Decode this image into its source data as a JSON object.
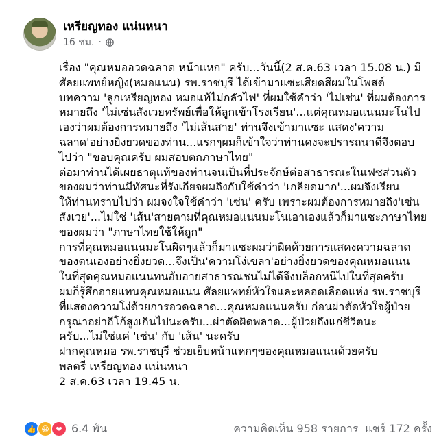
{
  "post": {
    "author": "เหรียญทอง แน่นหนา",
    "time": "16 ชม.",
    "lines": [
      "เรื่อง \"คุณหมออวดฉลาด หน้าแหก\" ครับ...วันนี้(2 ส.ค.63 เวลา 15.08 น.) มี",
      "ศัลยแพทย์หญิง(หมอแนน) รพ.ราชบุรี ได้เข้ามาแซะเสียดสีผมในโพสต์",
      "บทความ 'ลูกเหรียญทอง หมอแท้ไม่กลัวไฟ' ที่ผมใช้คำว่า 'ไม่เซ่น' ที่ผมต้องการ",
      "หมายถึง 'ไม่เซ่นสังเวยทรัพย์เพื่อให้ลูกเข้าโรงเรียน'...แต่คุณหมอแนนมะโนไป",
      "เองว่าผมต้องการหมายถึง 'ไม่เส้นสาย' ท่านจึงเข้ามาแซะ แสดง'ความ",
      "ฉลาด'อย่างยิ่งยวดของท่าน...แรกๆผมก็เข้าใจว่าท่านคงจะปรารถนาดีจึงตอบ",
      "ไปว่า \"ขอบคุณครับ ผมสอบตกภาษาไทย\"",
      "ต่อมาท่านได้เผยธาตุแท้ของท่านจนเป็นที่ประจักษ์ต่อสาธารณะในเฟซส่วนตัว",
      "ของผมว่าท่านมีทัศนะที่รังเกียจผมถึงกับใช้คำว่า 'เกลียดมาก'...ผมจึงเรียน",
      "ให้ท่านทราบไปว่า ผมจงใจใช้คำว่า 'เซ่น' ครับ เพราะผมต้องการหมายถึง'เซ่น",
      "สังเวย'...ไม่ใช่ 'เส้น'สายตามที่คุณหมอแนนมะโนเอาเองแล้วก็มาแซะภาษาไทย",
      "ของผมว่า \"ภาษาไทยใช้ให้ถูก\"",
      "การที่คุณหมอแนนมะโนผิดๆแล้วก็มาแซะผมว่าผิดด้วยการแสดงความฉลาด",
      "ของตนเองอย่างยิ่งยวด...จึงเป็น'ความโง่เขลา'อย่างยิ่งยวดของคุณหมอแนน",
      "ในที่สุดคุณหมอแนนทนอับอายสาธารณชนไม่ได้จึงบล็อกหนีไปในที่สุดครับ",
      "ผมก็รู้สึกอายแทนคุณหมอแนน ศัลยแพทย์หัวใจและหลอดเลือดแห่ง รพ.ราชบุรี",
      "ที่แสดงความโง่ด้วยการอวดฉลาด...คุณหมอแนนครับ ก่อนผ่าตัดหัวใจผู้ป่วย",
      "กรุณาอย่าอีโก้สูงเกินไปนะครับ...ผ่าตัดผิดพลาด...ผู้ป่วยถึงแก่ชีวิตนะ",
      "ครับ...ไม่ใช่แค่ 'เซ่น' กับ 'เส้น' นะครับ",
      "ฝากคุณหมอ รพ.ราชบุรี ช่วยเย็บหน้าแหกๆของคุณหมอแนนด้วยครับ",
      "พลตรี เหรียญทอง แน่นหนา",
      "2 ส.ค.63 เวลา 19.45 น."
    ],
    "reaction_count": "6.4 พัน",
    "comments": "ความคิดเห็น 958 รายการ",
    "shares": "แชร์ 172 ครั้ง"
  }
}
